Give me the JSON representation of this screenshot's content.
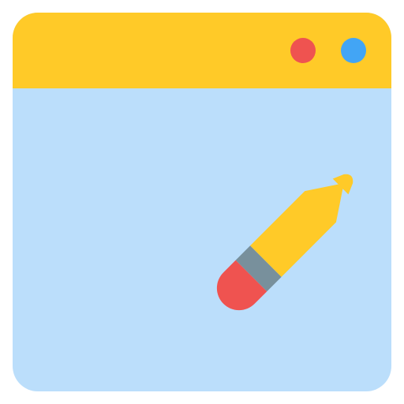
{
  "window": {
    "titlebar_color": "#ffca28",
    "content_color": "#bbdefb",
    "controls": [
      {
        "name": "close-button",
        "icon": "circle",
        "color": "#ef5350"
      },
      {
        "name": "maximize-button",
        "icon": "circle",
        "color": "#42a5f5"
      }
    ]
  },
  "content": {
    "icon": "pencil-icon",
    "colors": {
      "body": "#ffca28",
      "ferrule": "#78909c",
      "eraser": "#ef5350"
    }
  }
}
